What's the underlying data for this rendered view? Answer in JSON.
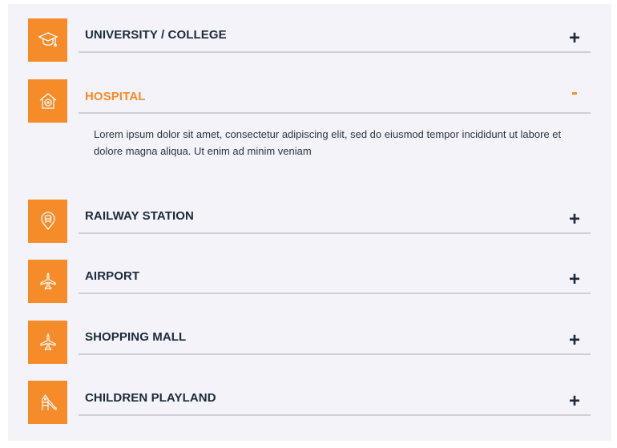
{
  "accordion": {
    "items": [
      {
        "title": "UNIVERSITY / COLLEGE",
        "toggle": "+",
        "icon": "graduation-cap-icon",
        "expanded": false
      },
      {
        "title": "HOSPITAL",
        "toggle": "-",
        "icon": "hospital-icon",
        "expanded": true,
        "body": "Lorem ipsum dolor sit amet, consectetur adipiscing elit, sed do eiusmod tempor incididunt ut labore et dolore magna aliqua. Ut enim ad minim veniam"
      },
      {
        "title": "RAILWAY STATION",
        "toggle": "+",
        "icon": "train-location-icon",
        "expanded": false
      },
      {
        "title": "AIRPORT",
        "toggle": "+",
        "icon": "airplane-icon",
        "expanded": false
      },
      {
        "title": "SHOPPING MALL",
        "toggle": "+",
        "icon": "airplane-icon",
        "expanded": false
      },
      {
        "title": "CHILDREN PLAYLAND",
        "toggle": "+",
        "icon": "playground-slide-icon",
        "expanded": false
      }
    ]
  },
  "colors": {
    "accent": "#f68b2a",
    "text": "#1b2a3c",
    "panel": "#f4f3f9",
    "divider": "#cfced4"
  }
}
